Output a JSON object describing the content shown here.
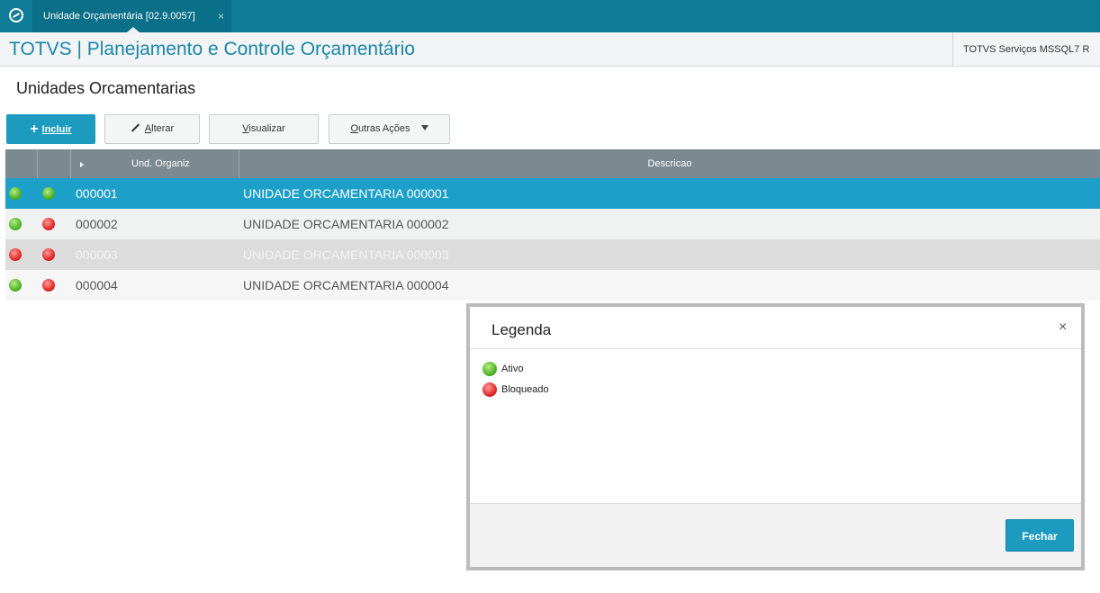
{
  "topbar": {
    "tab_label": "Unidade Orçamentária [02.9.0057]",
    "tab_close": "×"
  },
  "header": {
    "title": "TOTVS | Planejamento e Controle Orçamentário",
    "environment": "TOTVS Serviços MSSQL7 R"
  },
  "page": {
    "title": "Unidades Orcamentarias"
  },
  "toolbar": {
    "incluir": "Incluir",
    "alterar_ul": "A",
    "alterar_rest": "lterar",
    "visualizar_ul": "V",
    "visualizar_rest": "isualizar",
    "outras_ul": "O",
    "outras_rest": "utras Ações"
  },
  "grid": {
    "columns": [
      "",
      "",
      "Und. Organiz",
      "Descricao"
    ],
    "rows": [
      {
        "status1": "green",
        "status2": "green",
        "code": "000001",
        "desc": "UNIDADE ORCAMENTARIA 000001",
        "selected": true
      },
      {
        "status1": "green",
        "status2": "red",
        "code": "000002",
        "desc": "UNIDADE ORCAMENTARIA 000002",
        "selected": false
      },
      {
        "status1": "red",
        "status2": "red",
        "code": "000003",
        "desc": "UNIDADE ORCAMENTARIA 000003",
        "selected": false
      },
      {
        "status1": "green",
        "status2": "red",
        "code": "000004",
        "desc": "UNIDADE ORCAMENTARIA 000004",
        "selected": false
      }
    ]
  },
  "legend_dialog": {
    "title": "Legenda",
    "close": "×",
    "items": [
      {
        "color": "green",
        "label": "Ativo"
      },
      {
        "color": "red",
        "label": "Bloqueado"
      }
    ],
    "close_button": "Fechar"
  },
  "colors": {
    "brand": "#0e7c97",
    "accent": "#1c9ac0",
    "status_green": "#4fb526",
    "status_red": "#e22a2a"
  }
}
